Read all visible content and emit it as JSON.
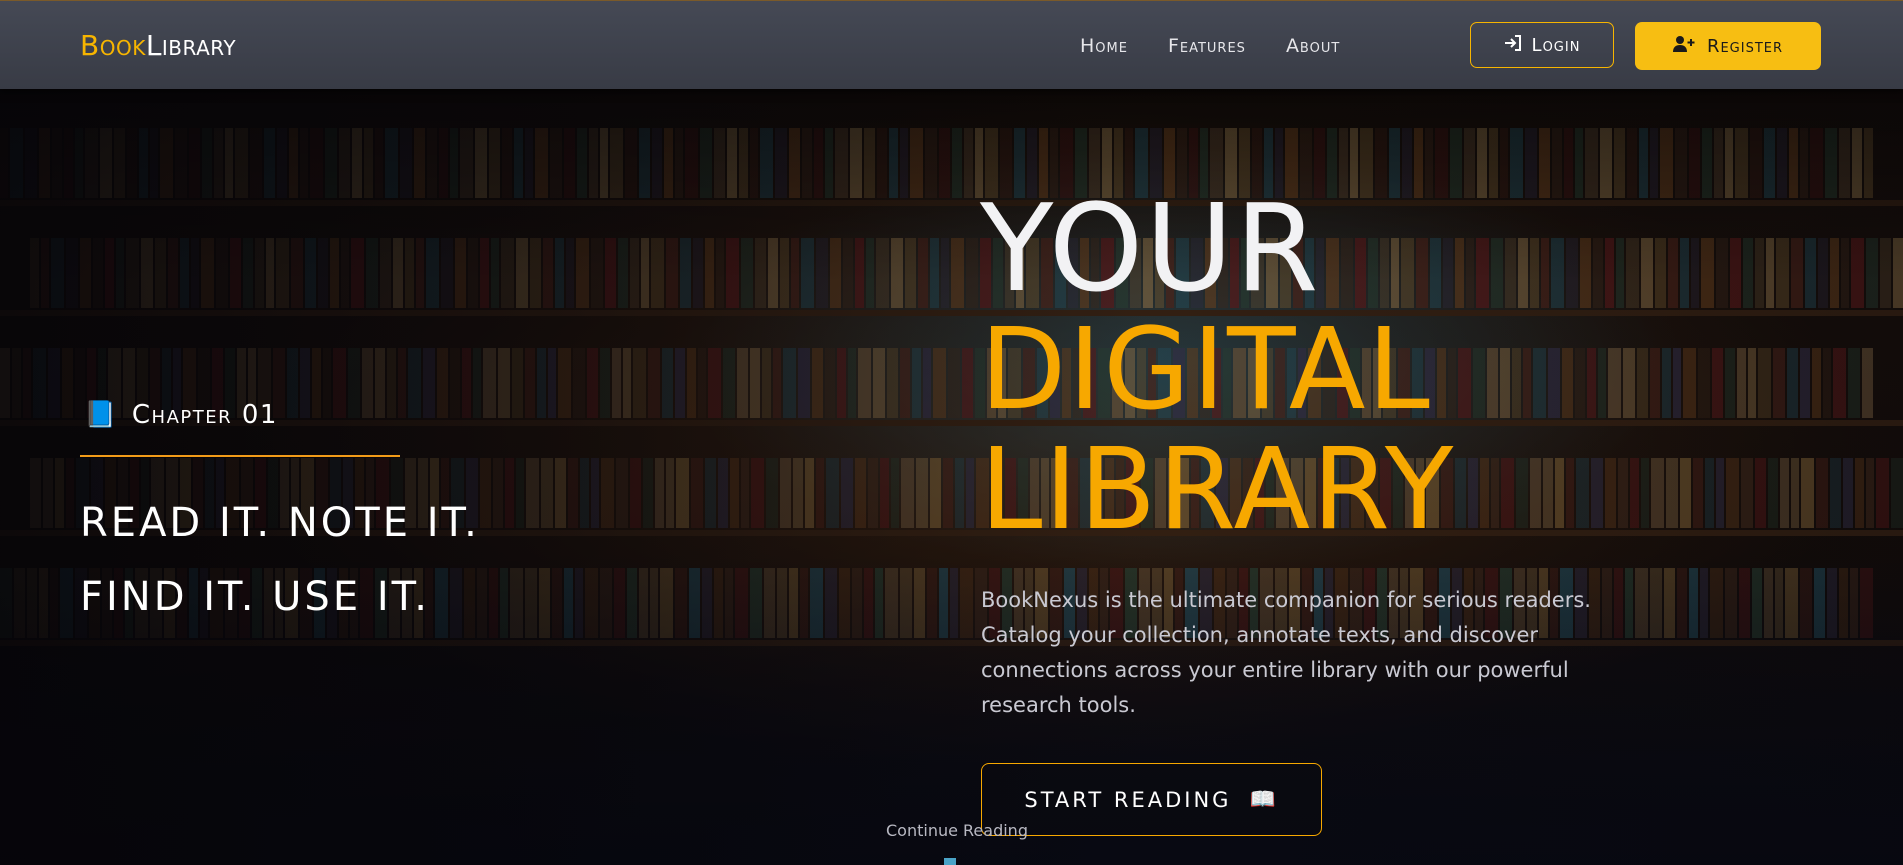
{
  "nav": {
    "logo_part1": "Book",
    "logo_part2": "Library",
    "links": [
      "Home",
      "Features",
      "About"
    ],
    "login_label": "Login",
    "register_label": "Register"
  },
  "hero": {
    "chapter_icon": "📘",
    "chapter_label": "Chapter 01",
    "tagline_1": "READ IT. NOTE IT.",
    "tagline_2": "FIND IT. USE IT.",
    "headline_1": "YOUR",
    "headline_2": "DIGITAL",
    "headline_3": "LIBRARY",
    "description": "BookNexus is the ultimate companion for serious readers. Catalog your collection, annotate texts, and discover connections across your entire library with our powerful research tools.",
    "cta_label": "START READING",
    "cta_icon": "📖",
    "continue_label": "Continue Reading"
  },
  "colors": {
    "accent": "#f7b500",
    "accent_orange": "#f7a800",
    "nav_bg": "#41444f"
  },
  "icons": {
    "login": "sign-in-icon",
    "register": "user-plus-icon"
  }
}
